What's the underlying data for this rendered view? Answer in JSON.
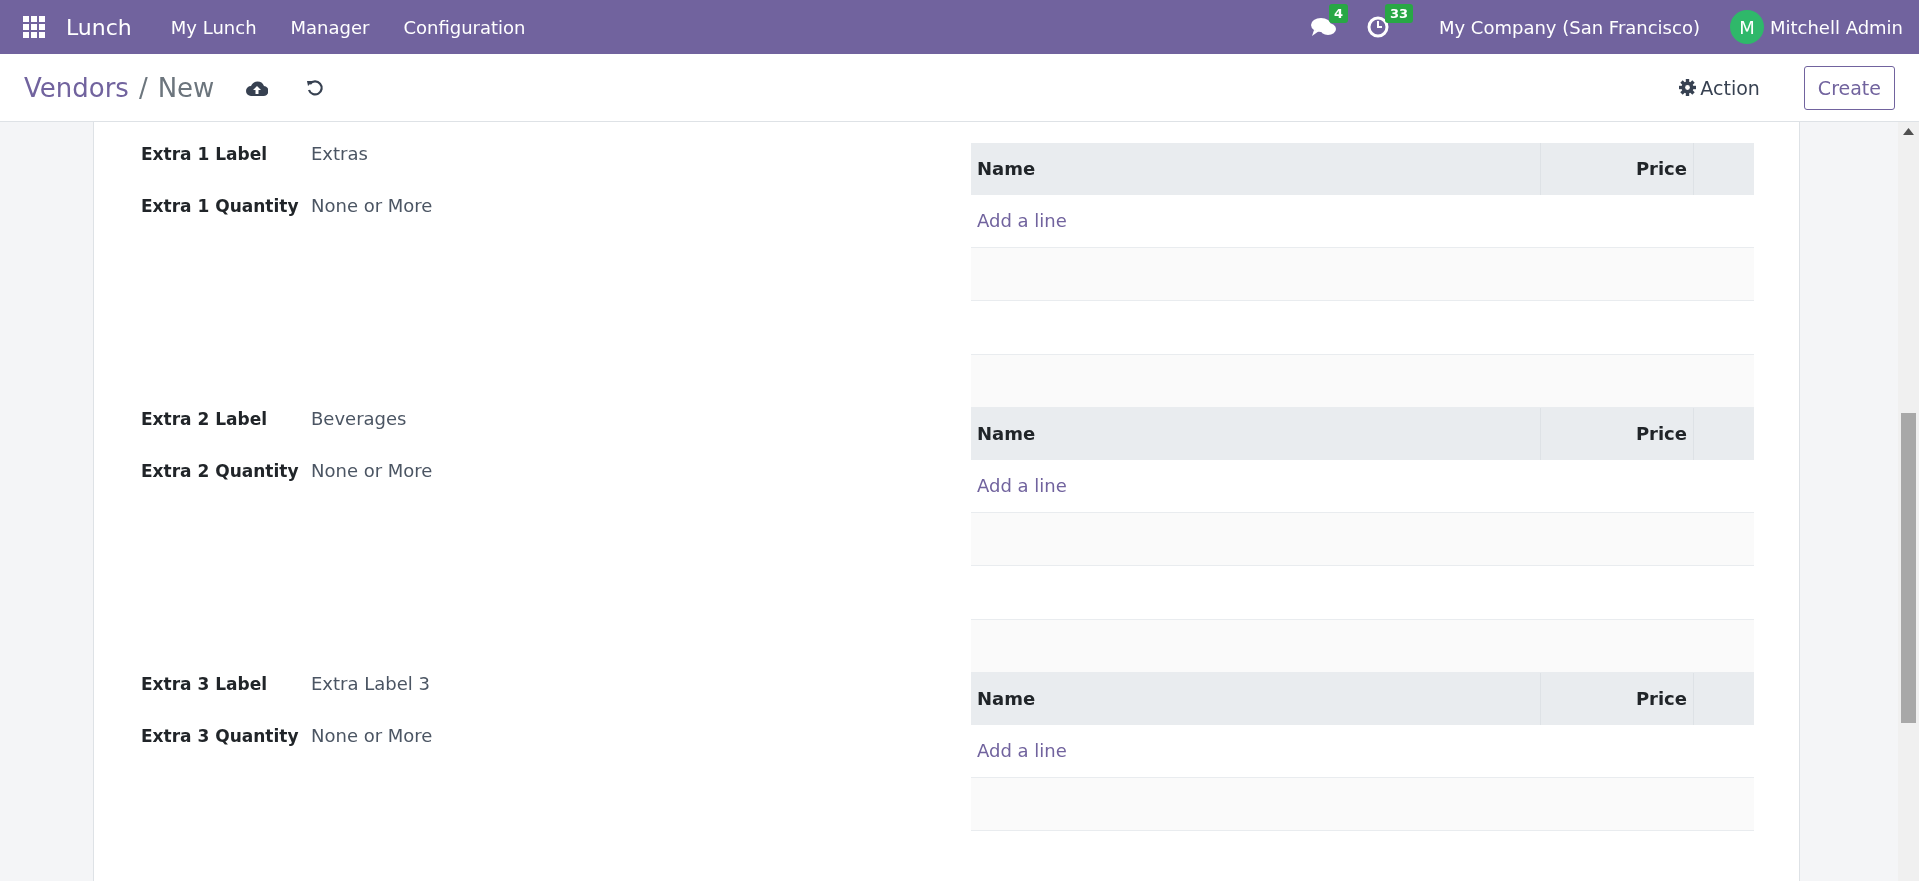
{
  "navbar": {
    "app_name": "Lunch",
    "menu": [
      {
        "label": "My Lunch"
      },
      {
        "label": "Manager"
      },
      {
        "label": "Configuration"
      }
    ],
    "messages_count": "4",
    "activities_count": "33",
    "company": "My Company (San Francisco)",
    "user_initial": "M",
    "user_name": "Mitchell Admin"
  },
  "control_panel": {
    "breadcrumb": "Vendors",
    "separator": "/",
    "current": "New",
    "action": "Action",
    "create": "Create"
  },
  "sections": [
    {
      "label_caption": "Extra 1 Label",
      "label_value": "Extras",
      "quantity_caption": "Extra 1 Quantity",
      "quantity_value": "None or More",
      "columns": [
        "Name",
        "Price"
      ],
      "add_line": "Add a line"
    },
    {
      "label_caption": "Extra 2 Label",
      "label_value": "Beverages",
      "quantity_caption": "Extra 2 Quantity",
      "quantity_value": "None or More",
      "columns": [
        "Name",
        "Price"
      ],
      "add_line": "Add a line"
    },
    {
      "label_caption": "Extra 3 Label",
      "label_value": "Extra Label 3",
      "quantity_caption": "Extra 3 Quantity",
      "quantity_value": "None or More",
      "columns": [
        "Name",
        "Price"
      ],
      "add_line": "Add a line"
    }
  ]
}
